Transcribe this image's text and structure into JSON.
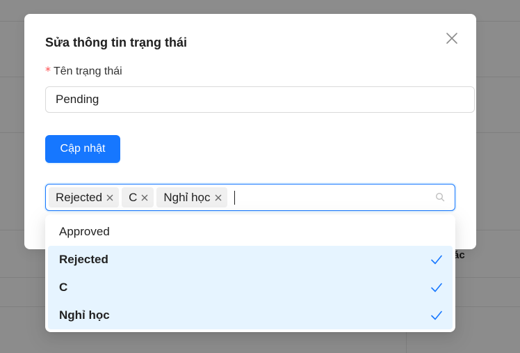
{
  "modal": {
    "title": "Sửa thông tin trạng thái",
    "field_label": "Tên trạng thái",
    "required_mark": "*",
    "input_value": "Pending",
    "update_button": "Cập nhật"
  },
  "background": {
    "partial_text": "ác"
  },
  "multi_select": {
    "tags": [
      "Rejected",
      "C",
      "Nghỉ học"
    ]
  },
  "dropdown": {
    "options": [
      {
        "label": "Approved",
        "selected": false
      },
      {
        "label": "Rejected",
        "selected": true
      },
      {
        "label": "C",
        "selected": true
      },
      {
        "label": "Nghỉ học",
        "selected": true
      }
    ]
  },
  "colors": {
    "primary": "#1677ff",
    "selected_bg": "#e6f4ff",
    "required": "#ff4d4f"
  },
  "icons": {
    "close": "close-icon",
    "tag_remove": "close-icon",
    "search": "search-icon",
    "check": "check-icon"
  }
}
